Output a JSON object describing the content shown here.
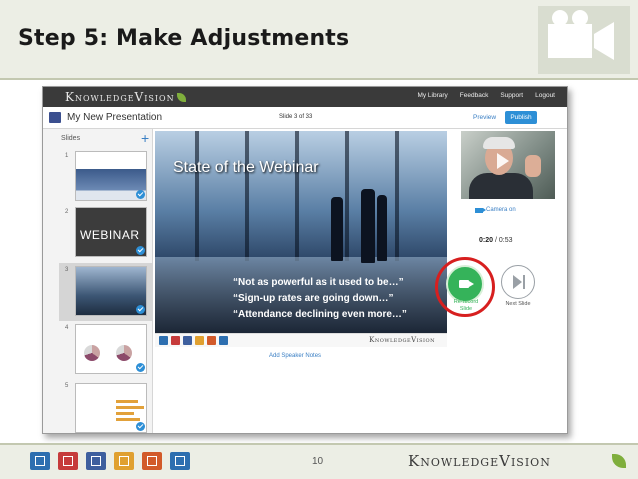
{
  "slide": {
    "title": "Step 5: Make Adjustments",
    "page_number": "10",
    "footer_brand": "KnowledgeVision"
  },
  "app": {
    "brand": "KnowledgeVision",
    "nav": [
      "My Library",
      "Feedback",
      "Support",
      "Logout"
    ],
    "presentation_title": "My New Presentation",
    "slide_counter": "Slide 3 of 33",
    "preview_label": "Preview",
    "publish_label": "Publish",
    "slides_label": "Slides",
    "add_slide": "+",
    "thumbnails": [
      {
        "number": "1",
        "text": ""
      },
      {
        "number": "2",
        "text": "WEBINAR"
      },
      {
        "number": "3",
        "text": ""
      },
      {
        "number": "4",
        "text": ""
      },
      {
        "number": "5",
        "text": ""
      }
    ],
    "main_slide": {
      "heading": "State of the Webinar",
      "quotes": [
        "“Not as powerful as it used to be…”",
        "“Sign-up rates are going down…”",
        "“Attendance declining even more…”"
      ],
      "footer_brand": "KnowledgeVision"
    },
    "speaker_notes": "Add Speaker Notes",
    "camera_on": "Camera on",
    "timer": {
      "elapsed": "0:20",
      "total": "0:53"
    },
    "rerecord_label": "Re-record Slide",
    "next_label": "Next Slide"
  },
  "colors": {
    "accent_blue": "#2d8fd6",
    "record_green": "#35b35a",
    "highlight_red": "#d71f1f",
    "brand_leaf": "#7fae3c"
  }
}
